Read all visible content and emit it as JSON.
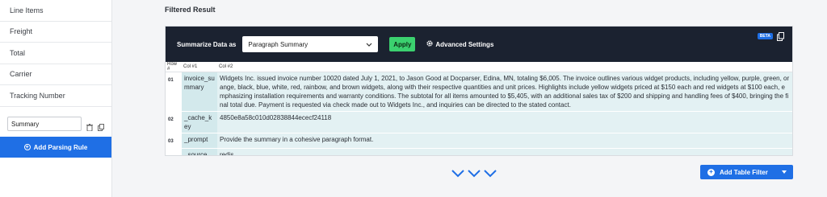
{
  "sidebar": {
    "items": [
      {
        "label": "Line Items"
      },
      {
        "label": "Freight"
      },
      {
        "label": "Total"
      },
      {
        "label": "Carrier"
      },
      {
        "label": "Tracking Number"
      }
    ],
    "rule_input_value": "Summary",
    "add_rule_label": "Add Parsing Rule"
  },
  "main": {
    "title": "Filtered Result",
    "toolbar": {
      "summarize_label": "Summarize Data as",
      "select_value": "Paragraph Summary",
      "apply_label": "Apply",
      "advanced_label": "Advanced Settings",
      "beta_label": "BETA"
    },
    "table": {
      "headers": [
        "Row #",
        "Col #1",
        "Col #2"
      ],
      "rows": [
        {
          "num": "01",
          "key": "invoice_summary",
          "value": "Widgets Inc. issued invoice number 10020 dated July 1, 2021, to Jason Good at Docparser, Edina, MN, totaling $6,005. The invoice outlines various widget products, including yellow, purple, green, orange, black, blue, white, red, rainbow, and brown widgets, along with their respective quantities and unit prices. Highlights include yellow widgets priced at $150 each and red widgets at $100 each, emphasizing installation requirements and warranty conditions. The subtotal for all items amounted to $5,405, with an additional sales tax of $200 and shipping and handling fees of $400, bringing the final total due. Payment is requested via check made out to Widgets Inc., and inquiries can be directed to the stated contact."
        },
        {
          "num": "02",
          "key": "_cache_key",
          "value": "4850e8a58c010d02838844ececf24118"
        },
        {
          "num": "03",
          "key": "_prompt",
          "value": "Provide the summary in a cohesive paragraph format."
        },
        {
          "num": "",
          "key": "_source",
          "value": "redis"
        }
      ]
    },
    "add_filter_label": "Add Table Filter"
  },
  "colors": {
    "accent": "#1f6fe5",
    "apply": "#3bd16f",
    "toolbar_bg": "#1b2230",
    "cell_key": "#d3e9ec",
    "cell_value": "#e3f1f3"
  }
}
